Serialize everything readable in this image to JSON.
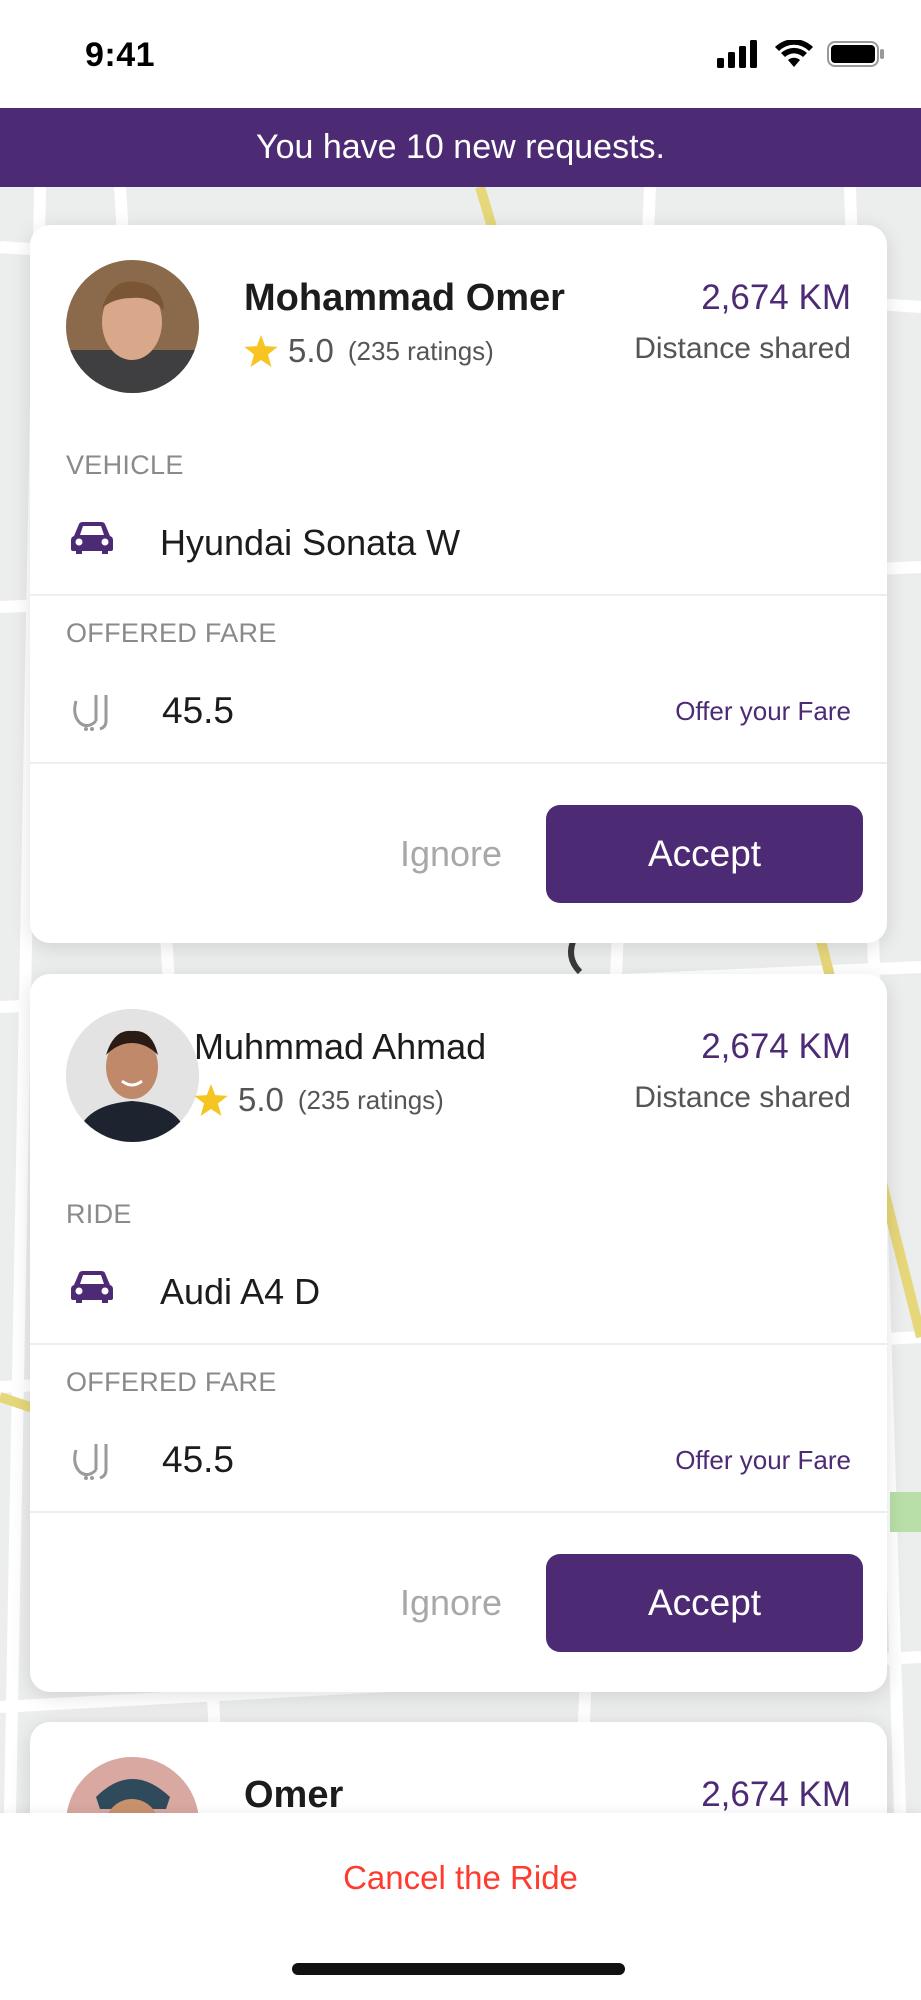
{
  "status_bar": {
    "time": "9:41"
  },
  "banner": {
    "text": "You have 10 new requests."
  },
  "cards": [
    {
      "name": "Mohammad Omer",
      "rating": "5.0",
      "rating_count": "(235 ratings)",
      "distance": "2,674 KM",
      "distance_label": "Distance shared",
      "section_label": "VEHICLE",
      "vehicle": "Hyundai Sonata W",
      "fare_label": "OFFERED FARE",
      "fare": "45.5",
      "offer_link": "Offer your Fare",
      "ignore_label": "Ignore",
      "accept_label": "Accept"
    },
    {
      "name": "Muhmmad Ahmad",
      "rating": "5.0",
      "rating_count": "(235 ratings)",
      "distance": "2,674 KM",
      "distance_label": "Distance shared",
      "section_label": "RIDE",
      "vehicle": "Audi A4 D",
      "fare_label": "OFFERED FARE",
      "fare": "45.5",
      "offer_link": "Offer your Fare",
      "ignore_label": "Ignore",
      "accept_label": "Accept"
    },
    {
      "name": "Omer",
      "distance": "2,674 KM"
    }
  ],
  "bottom": {
    "cancel_label": "Cancel the Ride"
  },
  "colors": {
    "brand": "#4d2a74",
    "danger": "#ff3b30",
    "star": "#f6c423"
  },
  "icons": [
    "signal-icon",
    "wifi-icon",
    "battery-icon",
    "star-icon",
    "car-icon",
    "riyal-icon"
  ]
}
